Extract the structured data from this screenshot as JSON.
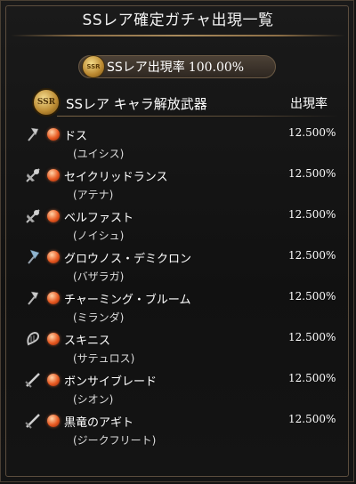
{
  "header": {
    "title": "SSレア確定ガチャ出現一覧"
  },
  "rate_banner": {
    "badge_text": "SSR",
    "label": "SSレア出現率",
    "value": "100.00%"
  },
  "section": {
    "badge_text": "SSR",
    "title": "SSレア キャラ解放武器",
    "rate_header": "出現率"
  },
  "items": [
    {
      "name": "ドス",
      "character": "(ユイシス)",
      "rate": "12.500%",
      "weapon_icon": "axe-icon"
    },
    {
      "name": "セイクリッドランス",
      "character": "(アテナ)",
      "rate": "12.500%",
      "weapon_icon": "lance-icon"
    },
    {
      "name": "ベルファスト",
      "character": "(ノイシュ)",
      "rate": "12.500%",
      "weapon_icon": "lance-icon"
    },
    {
      "name": "グロウノス・デミクロン",
      "character": "(バザラガ)",
      "rate": "12.500%",
      "weapon_icon": "axe-icon"
    },
    {
      "name": "チャーミング・ブルーム",
      "character": "(ミランダ)",
      "rate": "12.500%",
      "weapon_icon": "axe-icon"
    },
    {
      "name": "スキニス",
      "character": "(サテュロス)",
      "rate": "12.500%",
      "weapon_icon": "harp-icon"
    },
    {
      "name": "ボンサイブレード",
      "character": "(シオン)",
      "rate": "12.500%",
      "weapon_icon": "sword-icon"
    },
    {
      "name": "黒竜のアギト",
      "character": "(ジークフリート)",
      "rate": "12.500%",
      "weapon_icon": "sword-icon"
    }
  ]
}
